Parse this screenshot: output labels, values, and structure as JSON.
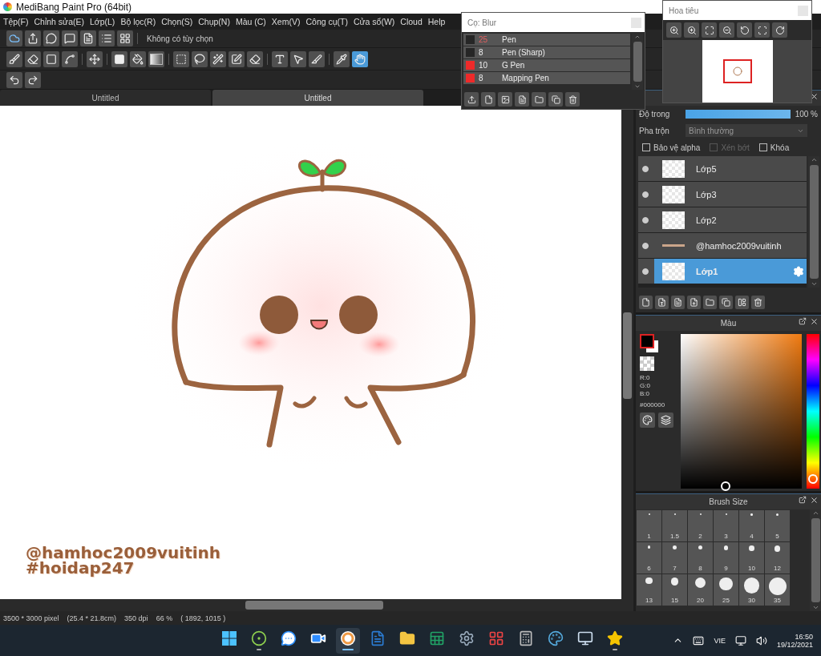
{
  "window": {
    "title": "MediBang Paint Pro (64bit)"
  },
  "menu": [
    "Tệp(F)",
    "Chỉnh sửa(E)",
    "Lớp(L)",
    "Bộ lọc(R)",
    "Chọn(S)",
    "Chụp(N)",
    "Màu (C)",
    "Xem(V)",
    "Công cụ(T)",
    "Cửa sổ(W)",
    "Cloud",
    "Help"
  ],
  "option_bar": {
    "tools": [
      {
        "kind": "cloud",
        "selected": false
      },
      {
        "kind": "share",
        "selected": false
      },
      {
        "kind": "speech-bubble",
        "selected": false
      },
      {
        "kind": "comment",
        "selected": false
      },
      {
        "kind": "document",
        "selected": false
      },
      {
        "kind": "list",
        "selected": false
      },
      {
        "kind": "grid",
        "selected": false
      }
    ],
    "text": "Không có tùy chọn"
  },
  "tool_bar": {
    "groups": [
      [
        {
          "kind": "brush",
          "selected": false
        },
        {
          "kind": "eraser",
          "selected": false
        },
        {
          "kind": "square",
          "selected": false
        },
        {
          "kind": "curve",
          "selected": false
        }
      ],
      [
        {
          "kind": "move",
          "selected": false
        }
      ],
      [
        {
          "kind": "filled-square",
          "selected": false
        },
        {
          "kind": "paint-bucket",
          "selected": false
        },
        {
          "kind": "gradient",
          "selected": false
        }
      ],
      [
        {
          "kind": "dashed-square",
          "selected": false
        },
        {
          "kind": "lasso",
          "selected": false
        },
        {
          "kind": "magic-wand",
          "selected": false
        },
        {
          "kind": "selection-pen",
          "selected": false
        },
        {
          "kind": "selection-eraser",
          "selected": false
        }
      ],
      [
        {
          "kind": "text",
          "selected": false
        },
        {
          "kind": "pointer",
          "selected": false
        },
        {
          "kind": "knife",
          "selected": false
        }
      ],
      [
        {
          "kind": "eyedropper",
          "selected": false
        },
        {
          "kind": "hand",
          "selected": true
        }
      ]
    ]
  },
  "history_bar": {
    "tools": [
      {
        "kind": "undo",
        "selected": false
      },
      {
        "kind": "redo",
        "selected": false
      }
    ]
  },
  "document_tabs": [
    {
      "label": "Untitled",
      "selected": false
    },
    {
      "label": "Untitled",
      "selected": true
    }
  ],
  "canvas": {
    "signature": [
      "@hamhoc2009vuitinh",
      "#hoidap247"
    ]
  },
  "brush_window": {
    "title": "Cọ: Blur",
    "brushes": [
      {
        "size": "25",
        "name": "Pen",
        "color": "#262626",
        "selected": true
      },
      {
        "size": "8",
        "name": "Pen (Sharp)",
        "color": "#262626",
        "selected": false
      },
      {
        "size": "10",
        "name": "G Pen",
        "color": "#ee2a2a",
        "selected": false
      },
      {
        "size": "8",
        "name": "Mapping Pen",
        "color": "#ee2a2a",
        "selected": false
      }
    ]
  },
  "navigator": {
    "title": "Hoa tiêu"
  },
  "layer_panel": {
    "opacity": {
      "label": "Độ trong",
      "level": 1,
      "reading": "100 %"
    },
    "blend": {
      "label": "Pha trộn",
      "value": "Bình thường"
    },
    "options": [
      {
        "label": "Bảo vệ alpha",
        "checked": false,
        "disabled": false
      },
      {
        "label": "Xén bớt",
        "checked": false,
        "disabled": true
      },
      {
        "label": "Khóa",
        "checked": false,
        "disabled": false
      }
    ],
    "layers": [
      {
        "name": "Lớp5",
        "kind": "raster",
        "visible": true,
        "selected": false
      },
      {
        "name": "Lớp3",
        "kind": "raster",
        "visible": true,
        "selected": false
      },
      {
        "name": "Lớp2",
        "kind": "raster",
        "visible": true,
        "selected": false
      },
      {
        "name": "@hamhoc2009vuitinh",
        "kind": "text",
        "visible": true,
        "selected": false
      },
      {
        "name": "Lớp1",
        "kind": "raster",
        "visible": true,
        "selected": true
      }
    ]
  },
  "color_panel": {
    "title": "Màu",
    "rgb": [
      "R:0",
      "G:0",
      "B:0"
    ],
    "hex": "#000000",
    "hue_slider": {
      "level": 0.03
    }
  },
  "brush_size_panel": {
    "title": "Brush Size",
    "sizes": [
      "1",
      "1.5",
      "2",
      "3",
      "4",
      "5",
      "6",
      "7",
      "8",
      "9",
      "10",
      "12",
      "13",
      "15",
      "20",
      "25",
      "30",
      "35"
    ]
  },
  "status_bar": [
    "3500 * 3000 pixel",
    "(25.4 * 21.8cm)",
    "350 dpi",
    "66 %",
    "( 1892, 1015 )"
  ],
  "taskbar": {
    "apps": [
      {
        "kind": "windows-logo",
        "running": false,
        "selected": false
      },
      {
        "kind": "ring-app",
        "running": true,
        "selected": false
      },
      {
        "kind": "chat-bubble",
        "running": false,
        "selected": false
      },
      {
        "kind": "video-camera",
        "running": false,
        "selected": false
      },
      {
        "kind": "paint-circle",
        "running": true,
        "selected": true
      },
      {
        "kind": "word-document",
        "running": false,
        "selected": false
      },
      {
        "kind": "folder",
        "running": false,
        "selected": false
      },
      {
        "kind": "spreadsheet",
        "running": false,
        "selected": false
      },
      {
        "kind": "gear",
        "running": false,
        "selected": false
      },
      {
        "kind": "cards",
        "running": false,
        "selected": false
      },
      {
        "kind": "calculator",
        "running": false,
        "selected": false
      },
      {
        "kind": "palette",
        "running": false,
        "selected": false
      },
      {
        "kind": "monitor",
        "running": false,
        "selected": false
      },
      {
        "kind": "star",
        "running": true,
        "selected": false
      }
    ],
    "language": "VIE",
    "time": "16:50",
    "date": "19/12/2021"
  }
}
